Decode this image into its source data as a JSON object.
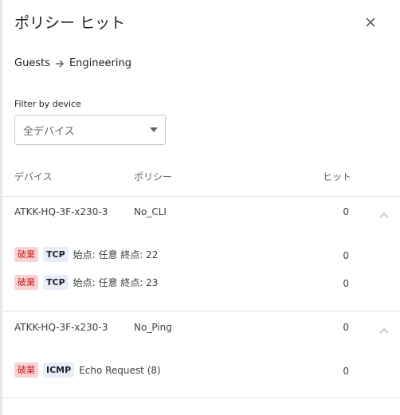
{
  "dialog": {
    "title": "ポリシー ヒット",
    "close_icon": "close-icon"
  },
  "breadcrumb": {
    "from": "Guests",
    "to": "Engineering"
  },
  "filter": {
    "label": "Filter by device",
    "selected": "全デバイス"
  },
  "table": {
    "headers": {
      "device": "デバイス",
      "policy": "ポリシー",
      "hits": "ヒット"
    },
    "groups": [
      {
        "device": "ATKK-HQ-3F-x230-3",
        "policy": "No_CLI",
        "hits": "0",
        "expanded": true,
        "rules": [
          {
            "action": "破棄",
            "protocol": "TCP",
            "desc": "始点: 任意 終点: 22",
            "hits": "0"
          },
          {
            "action": "破棄",
            "protocol": "TCP",
            "desc": "始点: 任意 終点: 23",
            "hits": "0"
          }
        ]
      },
      {
        "device": "ATKK-HQ-3F-x230-3",
        "policy": "No_Ping",
        "hits": "0",
        "expanded": true,
        "rules": [
          {
            "action": "破棄",
            "protocol": "ICMP",
            "desc": "Echo Request (8)",
            "hits": "0"
          }
        ]
      }
    ]
  },
  "colors": {
    "deny_bg": "#fad2d3",
    "deny_text": "#c5221f",
    "proto_bg": "#e8eef9",
    "divider": "#e0e0e0"
  }
}
